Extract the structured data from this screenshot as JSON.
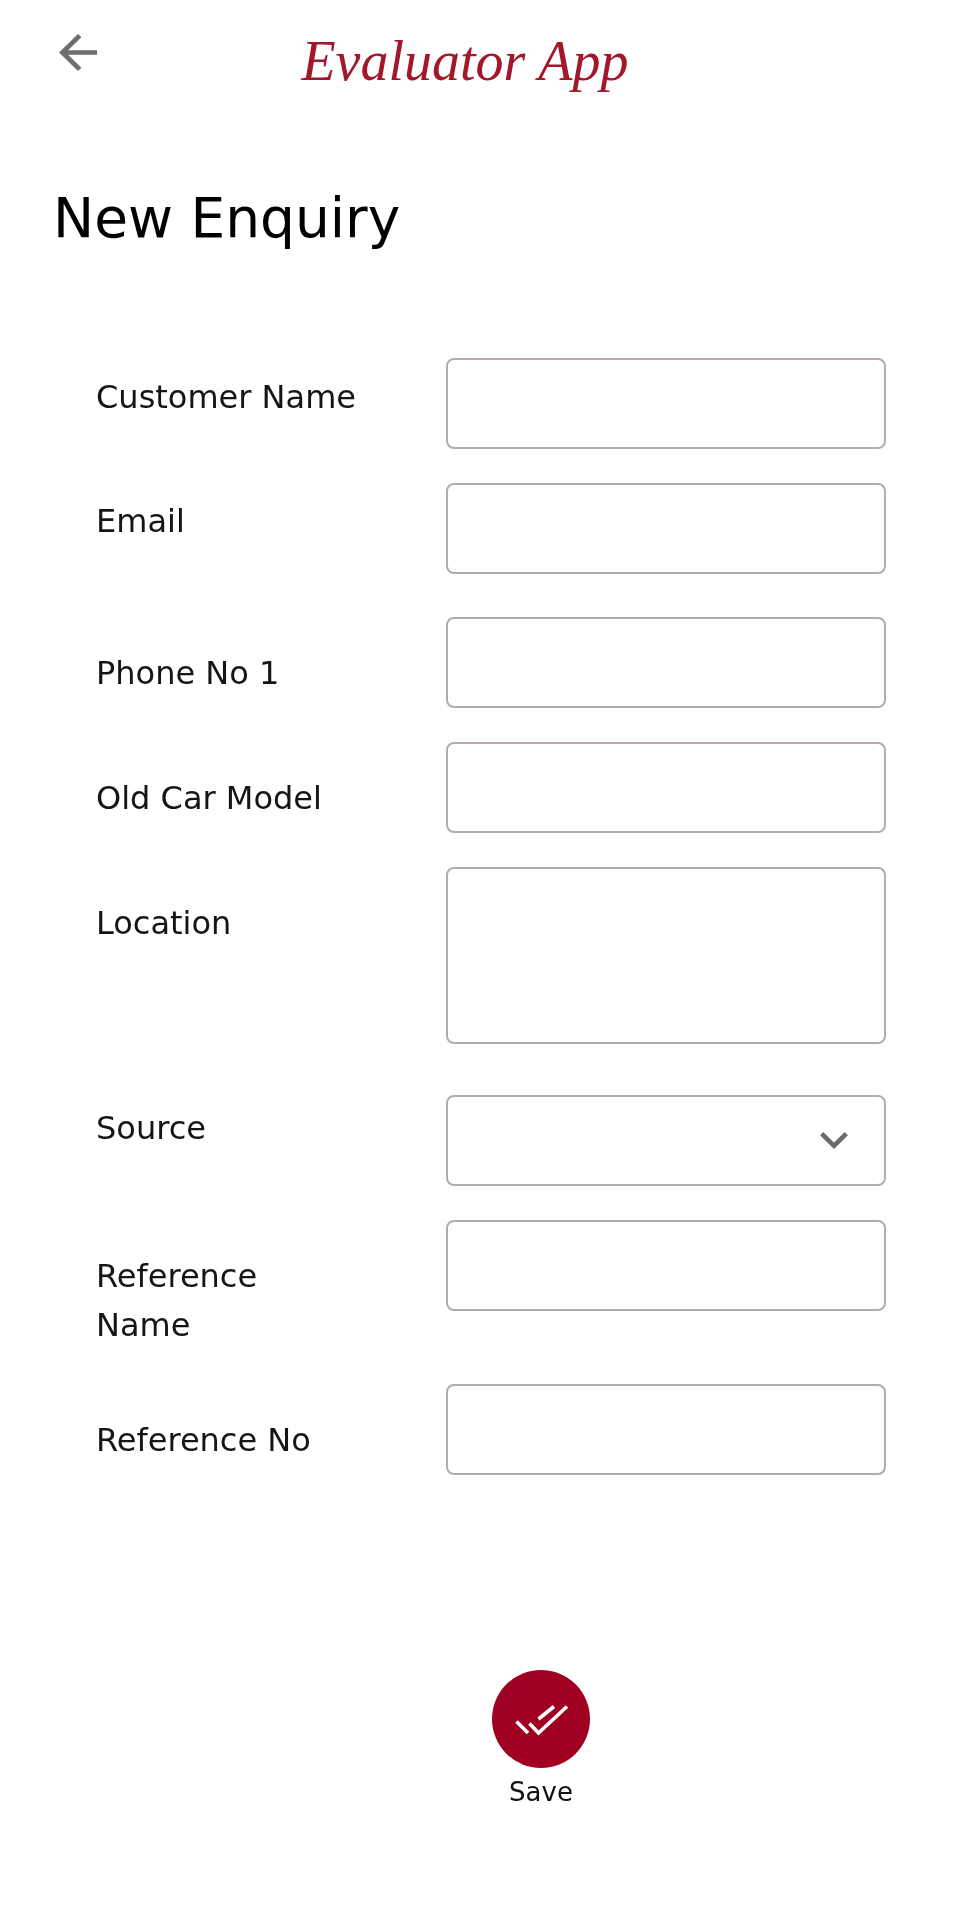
{
  "header": {
    "title": "Evaluator App"
  },
  "page_title": "New Enquiry",
  "form": {
    "fields": [
      {
        "label": "Customer Name",
        "kind": "text"
      },
      {
        "label": "Email",
        "kind": "text"
      },
      {
        "label": "Phone No 1",
        "kind": "text"
      },
      {
        "label": "Old Car Model",
        "kind": "text"
      },
      {
        "label": "Location",
        "kind": "textarea"
      },
      {
        "label": "Source",
        "kind": "dropdown"
      },
      {
        "label": "Reference Name",
        "kind": "text"
      },
      {
        "label": "Reference No",
        "kind": "text"
      }
    ]
  },
  "save_button": {
    "label": "Save"
  }
}
